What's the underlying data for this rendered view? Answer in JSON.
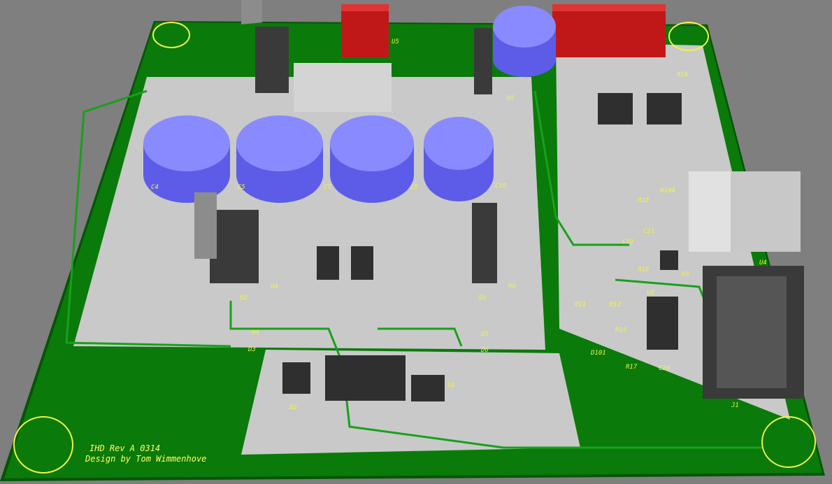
{
  "colors": {
    "background": "#7f7f7f",
    "board": "#0a7a0a",
    "board_edge": "#045504",
    "copper_pour": "#c9c9c9",
    "trace": "#17a11a",
    "silkscreen": "#f2f24a",
    "capacitor_top": "#8a8aff",
    "capacitor_side": "#5c5ce8",
    "relay": "#c01818",
    "ic_body": "#2f2f2f",
    "connector": "#c8c8c8"
  },
  "board": {
    "caption_line1": "IHD Rev A 0314",
    "caption_line2": "Design by Tom Wimmenhove"
  },
  "labels": {
    "u5": "U5",
    "q2": "Q2",
    "q3": "Q3",
    "r4": "R4",
    "r5": "R5",
    "r6": "R6",
    "d2": "D2",
    "d4": "D4",
    "d5": "D5",
    "d6": "D6",
    "d3": "D3",
    "u1": "U1",
    "u2": "U2",
    "u3": "U3",
    "u4": "U4",
    "j1": "J1",
    "r11": "R11",
    "r12": "R12",
    "r14": "R14",
    "r16": "R16",
    "r17": "R17",
    "r18": "R18",
    "r19": "R19",
    "d101": "D101",
    "d104": "D104",
    "c4": "C4",
    "c5": "C5",
    "c7": "C7",
    "c9": "C9",
    "c10": "C10",
    "c19": "C19",
    "c20": "C20",
    "c21": "C21"
  }
}
